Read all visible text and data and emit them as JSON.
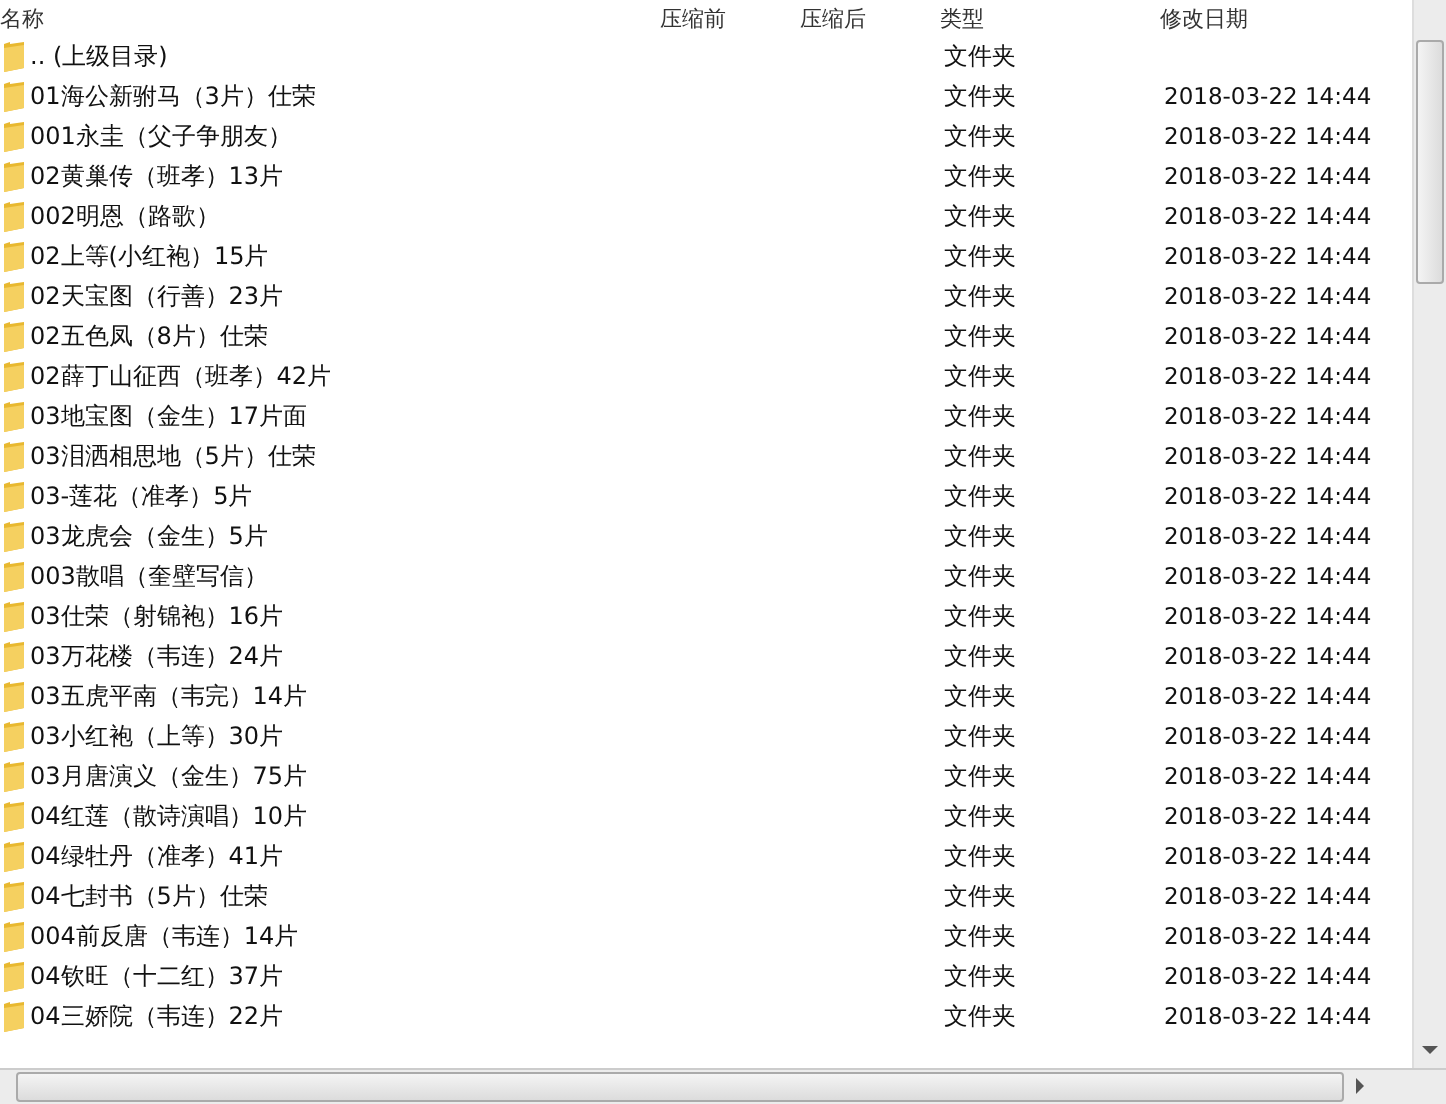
{
  "columns": [
    "名称",
    "压缩前",
    "压缩后",
    "类型",
    "修改日期"
  ],
  "rows": [
    {
      "name": ".. (上级目录)",
      "type": "文件夹",
      "modified": ""
    },
    {
      "name": "01海公新驸马（3片）仕荣",
      "type": "文件夹",
      "modified": "2018-03-22 14:44"
    },
    {
      "name": "001永圭（父子争朋友）",
      "type": "文件夹",
      "modified": "2018-03-22 14:44"
    },
    {
      "name": "02黄巢传（班孝）13片",
      "type": "文件夹",
      "modified": "2018-03-22 14:44"
    },
    {
      "name": "002明恩（路歌）",
      "type": "文件夹",
      "modified": "2018-03-22 14:44"
    },
    {
      "name": "02上等(小红袍）15片",
      "type": "文件夹",
      "modified": "2018-03-22 14:44"
    },
    {
      "name": "02天宝图（行善）23片",
      "type": "文件夹",
      "modified": "2018-03-22 14:44"
    },
    {
      "name": "02五色凤（8片）仕荣",
      "type": "文件夹",
      "modified": "2018-03-22 14:44"
    },
    {
      "name": "02薛丁山征西（班孝）42片",
      "type": "文件夹",
      "modified": "2018-03-22 14:44"
    },
    {
      "name": "03地宝图（金生）17片面",
      "type": "文件夹",
      "modified": "2018-03-22 14:44"
    },
    {
      "name": "03泪洒相思地（5片）仕荣",
      "type": "文件夹",
      "modified": "2018-03-22 14:44"
    },
    {
      "name": "03-莲花（准孝）5片",
      "type": "文件夹",
      "modified": "2018-03-22 14:44"
    },
    {
      "name": "03龙虎会（金生）5片",
      "type": "文件夹",
      "modified": "2018-03-22 14:44"
    },
    {
      "name": "003散唱（奎壁写信）",
      "type": "文件夹",
      "modified": "2018-03-22 14:44"
    },
    {
      "name": "03仕荣（射锦袍）16片",
      "type": "文件夹",
      "modified": "2018-03-22 14:44"
    },
    {
      "name": "03万花楼（韦连）24片",
      "type": "文件夹",
      "modified": "2018-03-22 14:44"
    },
    {
      "name": "03五虎平南（韦完）14片",
      "type": "文件夹",
      "modified": "2018-03-22 14:44"
    },
    {
      "name": "03小红袍（上等）30片",
      "type": "文件夹",
      "modified": "2018-03-22 14:44"
    },
    {
      "name": "03月唐演义（金生）75片",
      "type": "文件夹",
      "modified": "2018-03-22 14:44"
    },
    {
      "name": "04红莲（散诗演唱）10片",
      "type": "文件夹",
      "modified": "2018-03-22 14:44"
    },
    {
      "name": "04绿牡丹（准孝）41片",
      "type": "文件夹",
      "modified": "2018-03-22 14:44"
    },
    {
      "name": "04七封书（5片）仕荣",
      "type": "文件夹",
      "modified": "2018-03-22 14:44"
    },
    {
      "name": "004前反唐（韦连）14片",
      "type": "文件夹",
      "modified": "2018-03-22 14:44"
    },
    {
      "name": "04钦旺（十二红）37片",
      "type": "文件夹",
      "modified": "2018-03-22 14:44"
    },
    {
      "name": "04三娇院（韦连）22片",
      "type": "文件夹",
      "modified": "2018-03-22 14:44"
    }
  ]
}
